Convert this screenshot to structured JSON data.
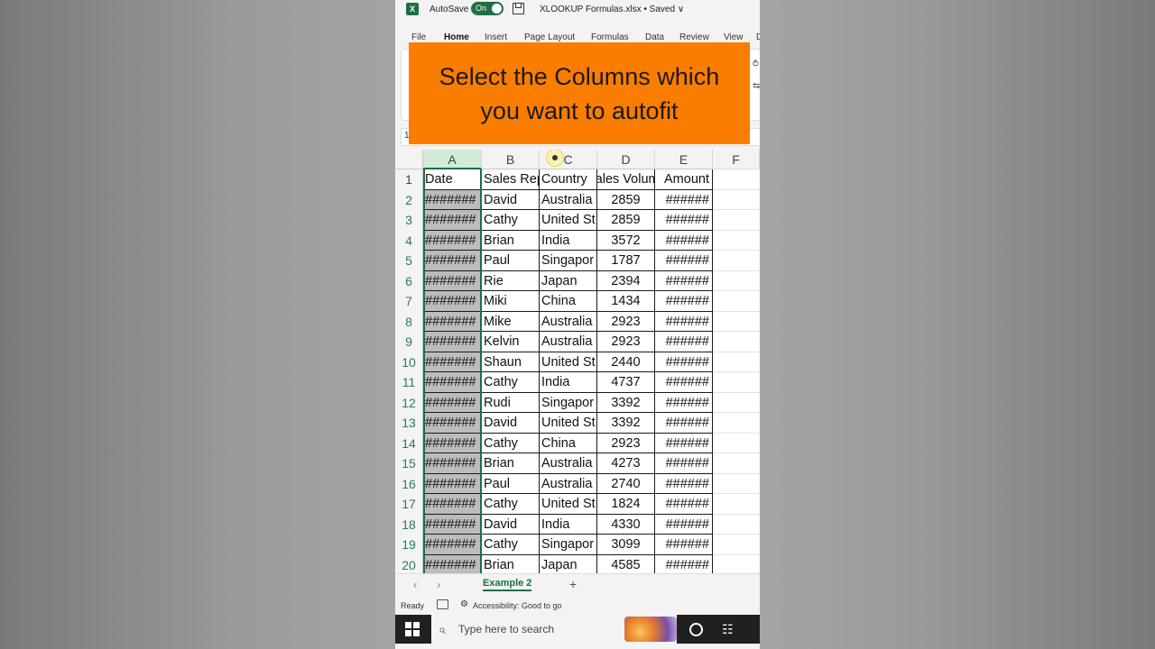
{
  "window": {
    "app_logo": "X",
    "autosave_label": "AutoSave",
    "autosave_state": "On",
    "filename": "XLOOKUP Formulas.xlsx • Saved ∨"
  },
  "ribbon": {
    "tabs": [
      "File",
      "Home",
      "Insert",
      "Page Layout",
      "Formulas",
      "Data",
      "Review",
      "View",
      "D"
    ],
    "active_tab": "Home"
  },
  "formula_bar": {
    "name_box": "1"
  },
  "overlay": {
    "text": "Select the Columns which you want to autofit"
  },
  "sheet": {
    "columns": [
      "A",
      "B",
      "C",
      "D",
      "E",
      "F"
    ],
    "selected_column": "A",
    "header_row": [
      "Date",
      "Sales Rep",
      "Country",
      "Sales Volume",
      "Amount"
    ],
    "rows": [
      {
        "n": "2",
        "date": "#######",
        "rep": "David",
        "country": "Australia",
        "volume": "2859",
        "amount": "######"
      },
      {
        "n": "3",
        "date": "#######",
        "rep": "Cathy",
        "country": "United St",
        "volume": "2859",
        "amount": "######"
      },
      {
        "n": "4",
        "date": "#######",
        "rep": "Brian",
        "country": "India",
        "volume": "3572",
        "amount": "######"
      },
      {
        "n": "5",
        "date": "#######",
        "rep": "Paul",
        "country": "Singapor",
        "volume": "1787",
        "amount": "######"
      },
      {
        "n": "6",
        "date": "#######",
        "rep": "Rie",
        "country": "Japan",
        "volume": "2394",
        "amount": "######"
      },
      {
        "n": "7",
        "date": "#######",
        "rep": "Miki",
        "country": "China",
        "volume": "1434",
        "amount": "######"
      },
      {
        "n": "8",
        "date": "#######",
        "rep": "Mike",
        "country": "Australia",
        "volume": "2923",
        "amount": "######"
      },
      {
        "n": "9",
        "date": "#######",
        "rep": "Kelvin",
        "country": "Australia",
        "volume": "2923",
        "amount": "######"
      },
      {
        "n": "10",
        "date": "#######",
        "rep": "Shaun",
        "country": "United St",
        "volume": "2440",
        "amount": "######"
      },
      {
        "n": "11",
        "date": "#######",
        "rep": "Cathy",
        "country": "India",
        "volume": "4737",
        "amount": "######"
      },
      {
        "n": "12",
        "date": "#######",
        "rep": "Rudi",
        "country": "Singapor",
        "volume": "3392",
        "amount": "######"
      },
      {
        "n": "13",
        "date": "#######",
        "rep": "David",
        "country": "United St",
        "volume": "3392",
        "amount": "######"
      },
      {
        "n": "14",
        "date": "#######",
        "rep": "Cathy",
        "country": "China",
        "volume": "2923",
        "amount": "######"
      },
      {
        "n": "15",
        "date": "#######",
        "rep": "Brian",
        "country": "Australia",
        "volume": "4273",
        "amount": "######"
      },
      {
        "n": "16",
        "date": "#######",
        "rep": "Paul",
        "country": "Australia",
        "volume": "2740",
        "amount": "######"
      },
      {
        "n": "17",
        "date": "#######",
        "rep": "Cathy",
        "country": "United St",
        "volume": "1824",
        "amount": "######"
      },
      {
        "n": "18",
        "date": "#######",
        "rep": "David",
        "country": "India",
        "volume": "4330",
        "amount": "######"
      },
      {
        "n": "19",
        "date": "#######",
        "rep": "Cathy",
        "country": "Singapor",
        "volume": "3099",
        "amount": "######"
      },
      {
        "n": "20",
        "date": "#######",
        "rep": "Brian",
        "country": "Japan",
        "volume": "4585",
        "amount": "######"
      }
    ]
  },
  "sheet_tabs": {
    "prev": "‹",
    "next": "›",
    "active": "Example 2",
    "add": "+"
  },
  "status": {
    "ready": "Ready",
    "accessibility": "Accessibility: Good to go"
  },
  "taskbar": {
    "search_placeholder": "Type here to search"
  },
  "colors": {
    "excel_green": "#1d6f42",
    "overlay_orange": "#fa7d00",
    "selected_column": "#bcbcbc"
  },
  "icons": [
    "excel-logo-icon",
    "save-icon",
    "windows-start-icon",
    "search-icon",
    "cortana-icon",
    "task-view-icon",
    "macro-icon",
    "accessibility-icon"
  ]
}
